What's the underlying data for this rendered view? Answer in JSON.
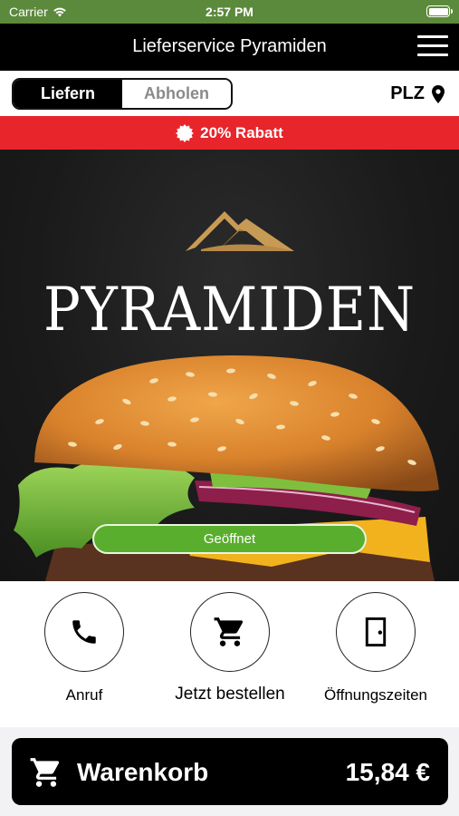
{
  "status_bar": {
    "carrier": "Carrier",
    "time": "2:57 PM"
  },
  "nav": {
    "title": "Lieferservice Pyramiden",
    "menu_icon": "hamburger-menu-icon"
  },
  "mode": {
    "deliver_label": "Liefern",
    "pickup_label": "Abholen",
    "selected": "Liefern",
    "plz_label": "PLZ",
    "plz_icon": "location-pin-icon"
  },
  "discount": {
    "label": "20% Rabatt",
    "icon": "badge-icon",
    "color": "#e8252b"
  },
  "hero": {
    "brand": "PYRAMIDEN",
    "status_label": "Geöffnet",
    "status_color": "#5aae2e"
  },
  "actions": [
    {
      "label": "Anruf",
      "icon": "phone-icon"
    },
    {
      "label": "Jetzt bestellen",
      "icon": "cart-icon"
    },
    {
      "label": "Öffnungszeiten",
      "icon": "door-icon"
    }
  ],
  "cart": {
    "label": "Warenkorb",
    "total": "15,84 €",
    "icon": "cart-icon"
  },
  "colors": {
    "status_bar": "#5c8a3c",
    "nav_bg": "#000000",
    "accent_red": "#e8252b",
    "open_green": "#5aae2e"
  }
}
